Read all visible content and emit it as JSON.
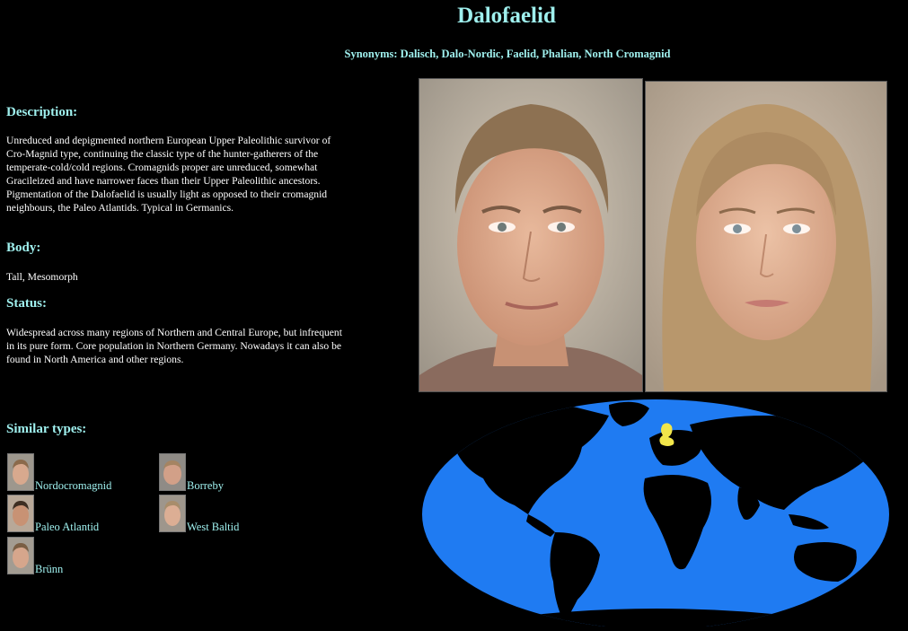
{
  "page": {
    "title": "Dalofaelid",
    "synonyms": "Synonyms: Dalisch, Dalo-Nordic, Faelid, Phalian, North Cromagnid"
  },
  "description": {
    "title": "Description:",
    "text": "Unreduced and depigmented northern European Upper Paleolithic survivor of Cro-Magnid type, continuing the classic type of the hunter-gatherers of the temperate-cold/cold regions. Cromagnids proper are unreduced, somewhat Gracileized and have narrower faces than their Upper Paleolithic ancestors. Pigmentation of the Dalofaelid is usually light as opposed to their cromagnid neighbours, the Paleo Atlantids. Typical in Germanics."
  },
  "body": {
    "title": "Body:",
    "text": "Tall, Mesomorph"
  },
  "status": {
    "title": "Status:",
    "text": "Widespread across many regions of Northern and Central Europe, but infrequent in its pure form. Core population in Northern Germany. Nowadays it can also be found in North America and other regions."
  },
  "similar": {
    "title": "Similar types:",
    "items": [
      {
        "label": "Nordocromagnid"
      },
      {
        "label": "Borreby"
      },
      {
        "label": "Paleo Atlantid"
      },
      {
        "label": "West Baltid"
      },
      {
        "label": "Brünn"
      }
    ]
  },
  "colors": {
    "accent": "#9ff0ee",
    "ocean": "#1f7bf2",
    "land": "#000000",
    "highlight": "#f2e64a"
  }
}
